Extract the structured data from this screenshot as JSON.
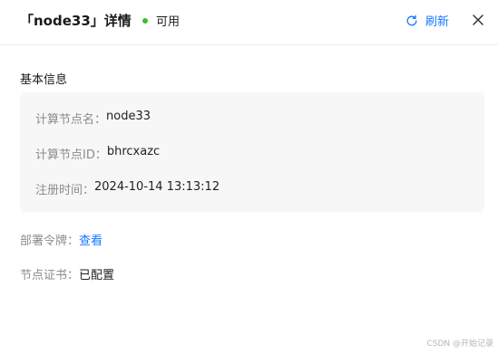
{
  "header": {
    "title": "「node33」详情",
    "status_label": "可用",
    "status_color": "#3dbd3a",
    "refresh_label": "刷新",
    "refresh_icon": "refresh-icon",
    "close_icon": "close-icon"
  },
  "basic_info": {
    "section_title": "基本信息",
    "rows": [
      {
        "label": "计算节点名：",
        "value": "node33"
      },
      {
        "label": "计算节点ID：",
        "value": "bhrcxazc"
      },
      {
        "label": "注册时间：",
        "value": "2024-10-14 13:13:12"
      }
    ]
  },
  "deploy_token": {
    "label": "部署令牌：",
    "link_text": "查看"
  },
  "node_cert": {
    "label": "节点证书：",
    "value": "已配置"
  },
  "watermark": "CSDN @开始记录",
  "colors": {
    "accent": "#1677ff",
    "card_bg": "#f7f7f8"
  }
}
